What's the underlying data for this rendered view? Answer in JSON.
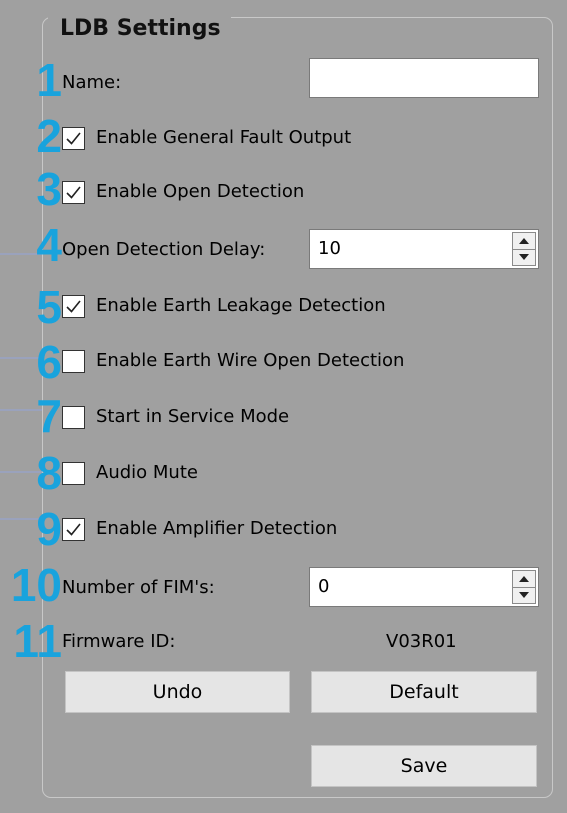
{
  "group": {
    "title": "LDB Settings"
  },
  "markers": [
    "1",
    "2",
    "3",
    "4",
    "5",
    "6",
    "7",
    "8",
    "9",
    "10",
    "11"
  ],
  "name_field": {
    "label": "Name:",
    "value": ""
  },
  "checkboxes": [
    {
      "label": "Enable General Fault Output",
      "checked": true
    },
    {
      "label": "Enable Open Detection",
      "checked": true
    },
    {
      "label": "Enable Earth Leakage Detection",
      "checked": true
    },
    {
      "label": "Enable Earth Wire Open Detection",
      "checked": false
    },
    {
      "label": "Start in Service Mode",
      "checked": false
    },
    {
      "label": "Audio Mute",
      "checked": false
    },
    {
      "label": "Enable Amplifier Detection",
      "checked": true
    }
  ],
  "open_detection_delay": {
    "label": "Open Detection Delay:",
    "value": "10"
  },
  "number_of_fims": {
    "label": "Number of FIM's:",
    "value": "0"
  },
  "firmware": {
    "label": "Firmware ID:",
    "value": "V03R01"
  },
  "buttons": {
    "undo": "Undo",
    "default": "Default",
    "save": "Save"
  }
}
